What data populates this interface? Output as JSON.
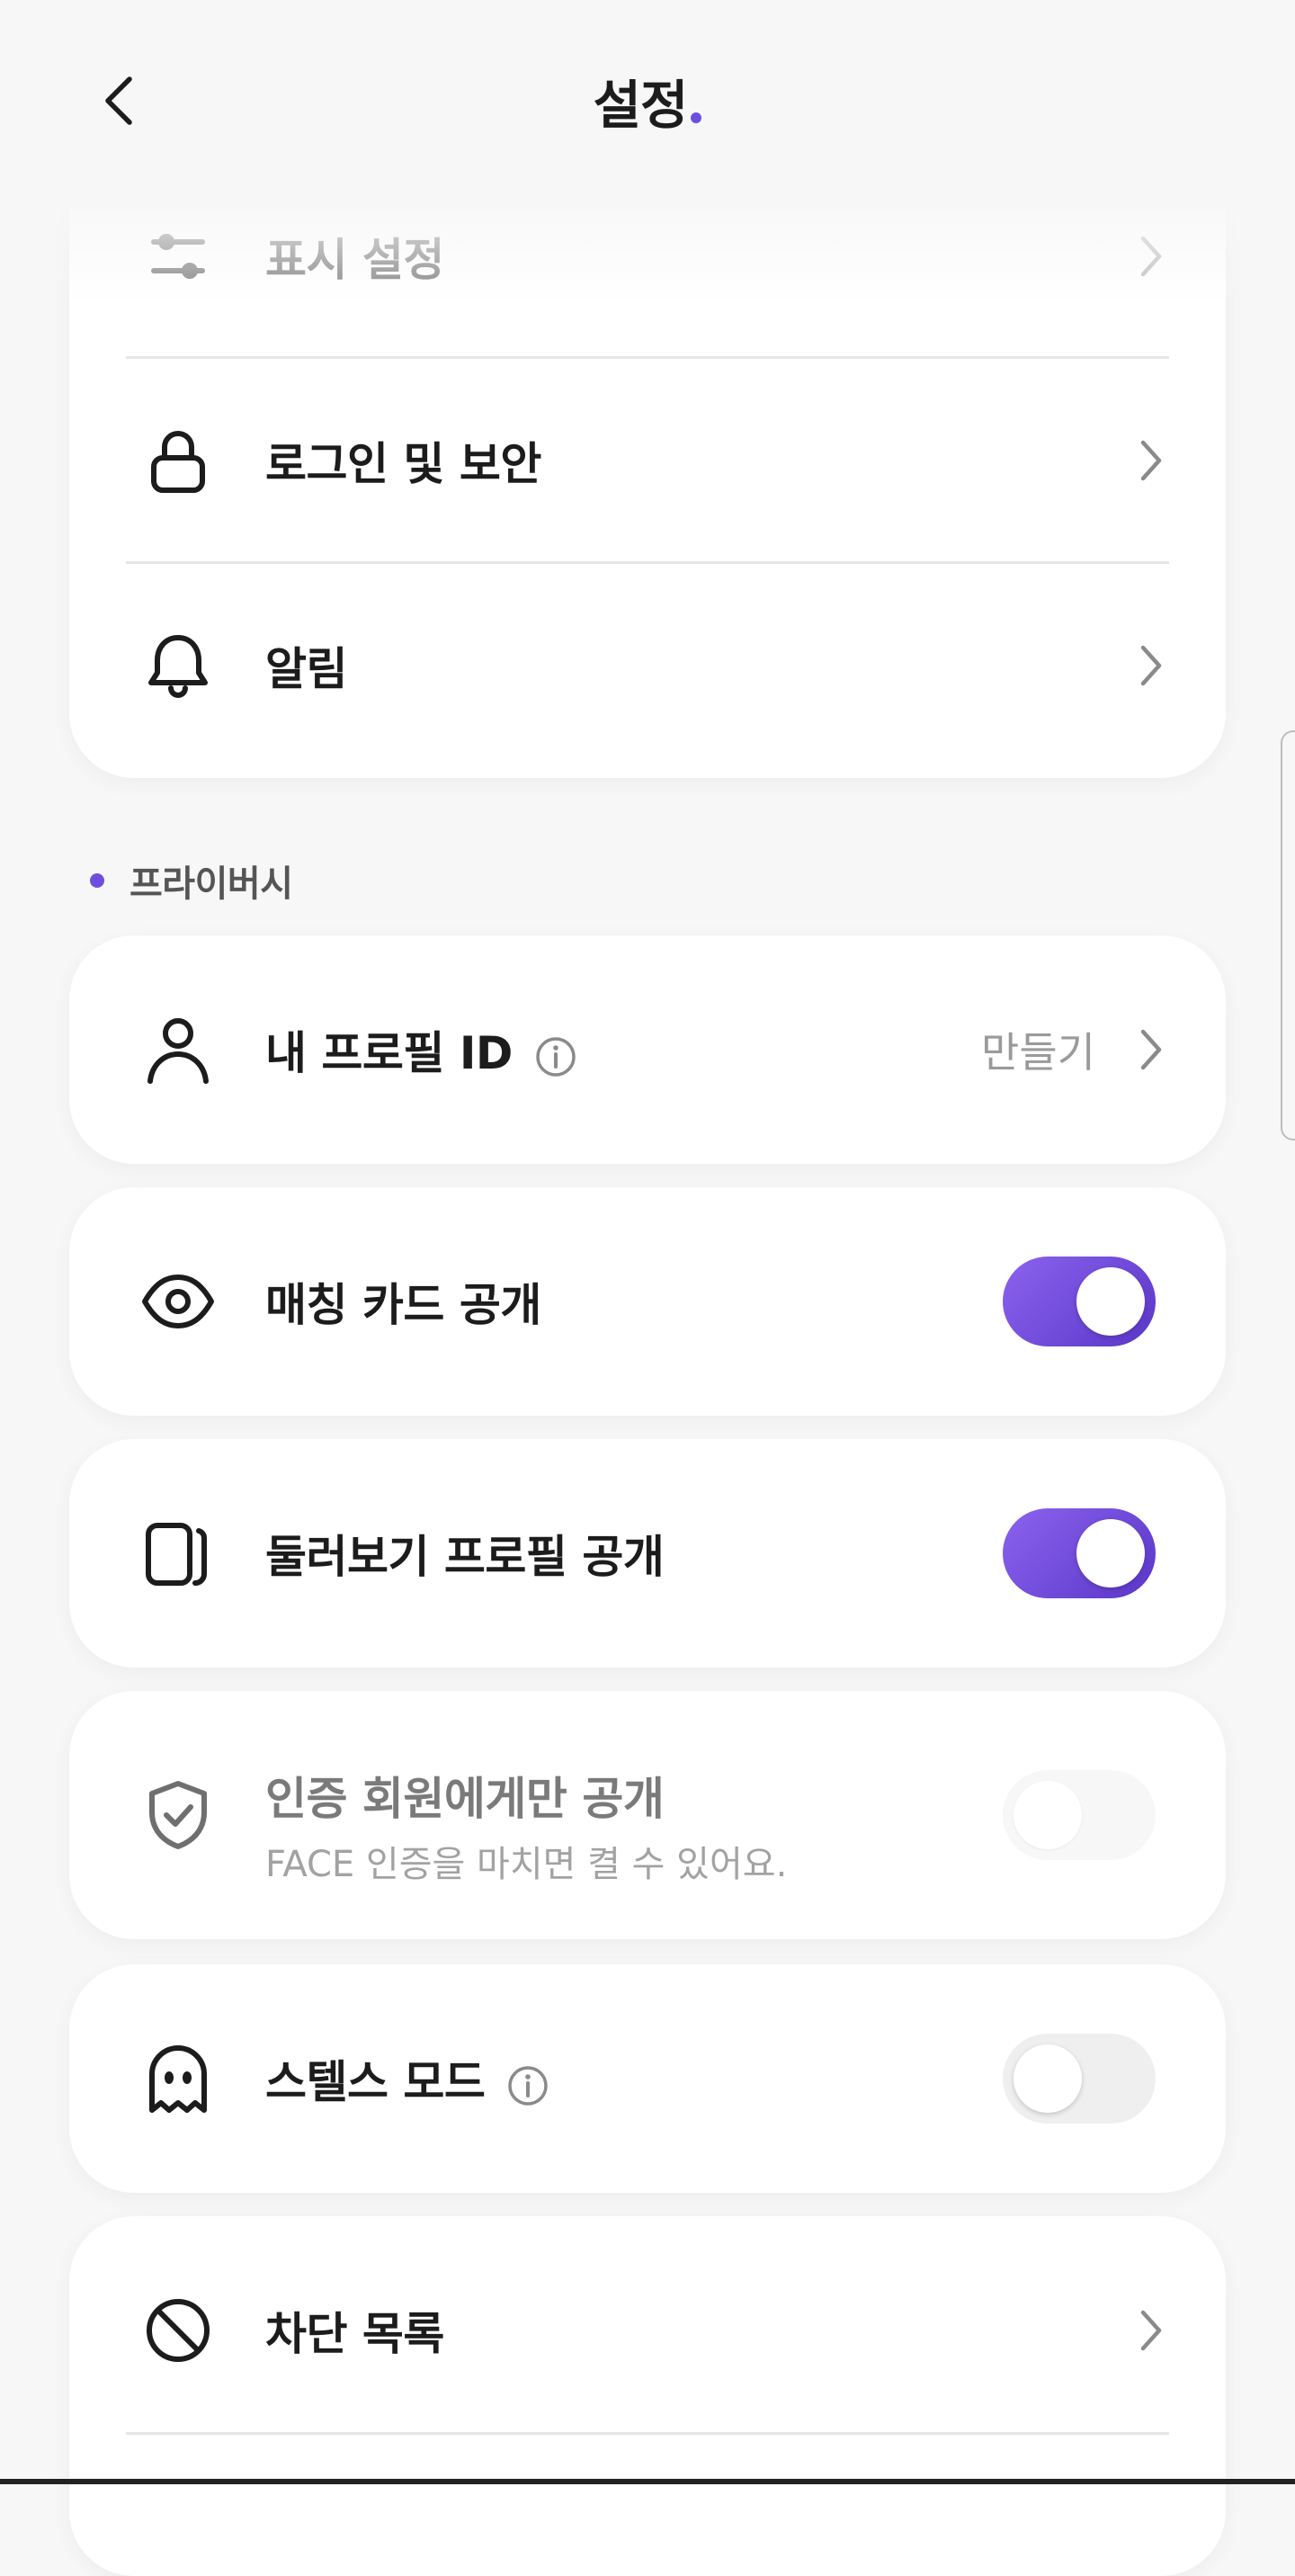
{
  "header": {
    "title": "설정",
    "back_icon": "chevron-left-icon",
    "accent_color": "#6d4fe0"
  },
  "account_card": {
    "items": [
      {
        "label": "표시 설정",
        "icon": "sliders-icon"
      },
      {
        "label": "로그인 및 보안",
        "icon": "lock-icon"
      },
      {
        "label": "알림",
        "icon": "bell-icon"
      }
    ]
  },
  "privacy": {
    "section_label": "프라이버시",
    "profile_id": {
      "label": "내 프로필 ID",
      "action": "만들기",
      "icon": "person-icon"
    },
    "matching_card": {
      "label": "매칭 카드 공개",
      "enabled": true,
      "icon": "eye-icon"
    },
    "browse_profile": {
      "label": "둘러보기 프로필 공개",
      "enabled": true,
      "icon": "cards-icon"
    },
    "verified_only": {
      "label": "인증 회원에게만 공개",
      "sublabel": "FACE 인증을 마치면 켤 수 있어요.",
      "enabled": false,
      "disabled": true,
      "icon": "shield-check-icon"
    },
    "stealth_mode": {
      "label": "스텔스 모드",
      "enabled": false,
      "icon": "ghost-icon"
    },
    "block_list": {
      "label": "차단 목록",
      "icon": "block-icon"
    }
  },
  "colors": {
    "toggle_on_start": "#8b63ee",
    "toggle_on_end": "#5a36c8",
    "background": "#f7f7f7"
  }
}
